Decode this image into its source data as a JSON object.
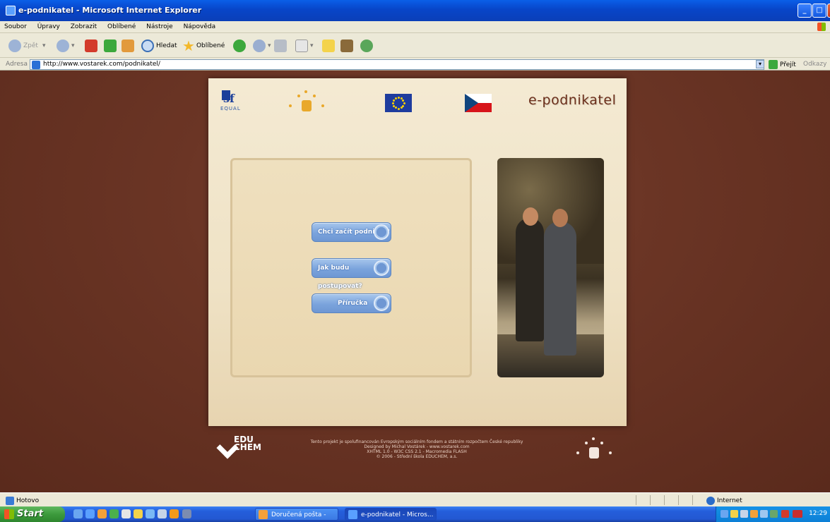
{
  "window": {
    "title": "e-podnikatel - Microsoft Internet Explorer"
  },
  "menu": [
    "Soubor",
    "Úpravy",
    "Zobrazit",
    "Oblíbené",
    "Nástroje",
    "Nápověda"
  ],
  "toolbar": {
    "back_label": "Zpět",
    "search_label": "Hledat",
    "favorites_label": "Oblíbené"
  },
  "address": {
    "label": "Adresa",
    "url": "http://www.vostarek.com/podnikatel/",
    "go_label": "Přejít",
    "links_label": "Odkazy"
  },
  "page": {
    "brand": "e-podnikatel",
    "esf_text": "sf",
    "equal_text": "EQUAL",
    "buttons": [
      "Chci začít podnikat?",
      "Jak budu postupovat?",
      "Příručka"
    ],
    "footer_lines": [
      "Tento projekt je spolufinancován Evropským sociálním fondem a státním rozpočtem České republiky",
      "Designed by Michal Vostárek - www.vostarek.com",
      "XHTML 1.0 - W3C CSS 2.1 - Macromedia FLASH",
      "© 2006 - Střední škola EDUCHEM, a.s."
    ],
    "educhem_top": "EDU",
    "educhem_bottom": "CHEM"
  },
  "status": {
    "left": "Hotovo",
    "zone": "Internet"
  },
  "taskbar": {
    "start_label": "Start",
    "tasks": [
      "Doručená pošta - Mic...",
      "e-podnikatel - Micros..."
    ],
    "clock": "12:29"
  },
  "colors": {
    "page_bg": "#6b3525",
    "panel": "#f2e6cb",
    "button": "#7aa3dc",
    "brand_text": "#6b2e1a"
  }
}
